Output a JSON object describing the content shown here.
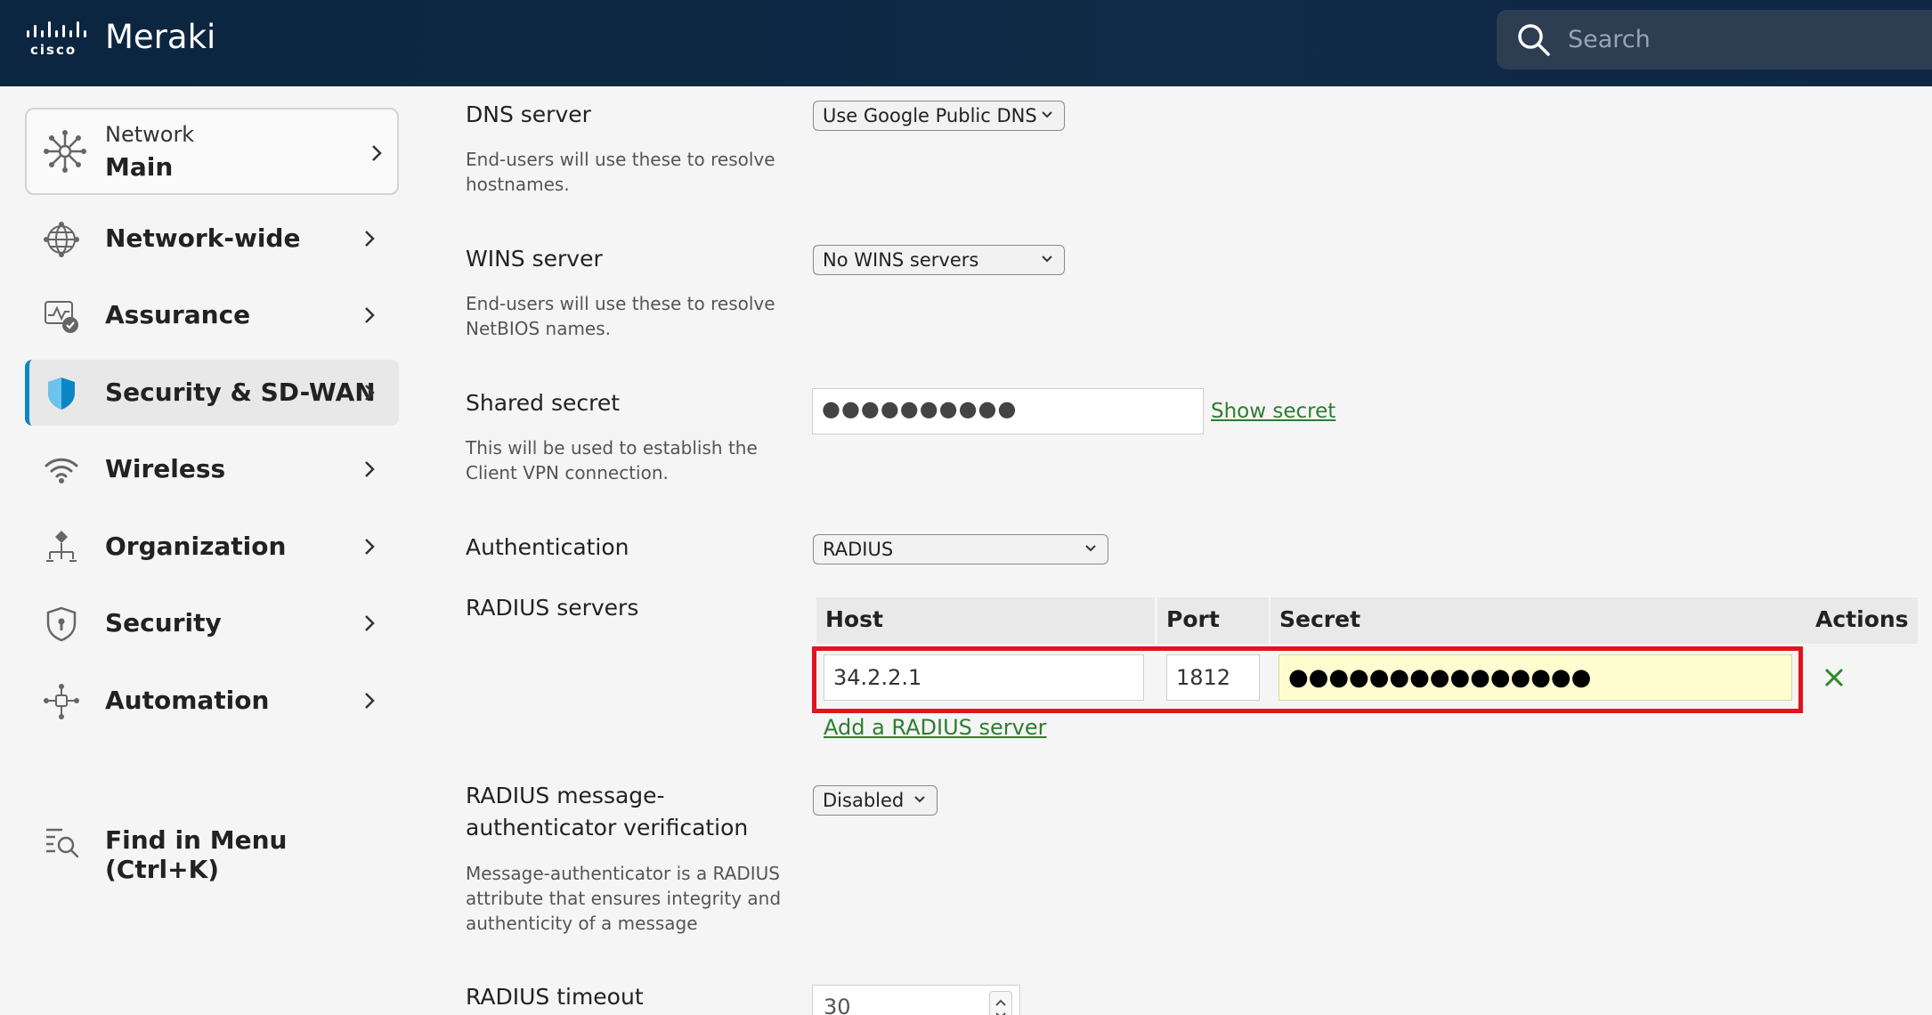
{
  "header": {
    "logo_text": "cisco",
    "app_name": "Meraki",
    "search_placeholder": "Search"
  },
  "sidebar": {
    "network": {
      "label": "Network",
      "value": "Main"
    },
    "items": [
      {
        "label": "Network-wide",
        "icon": "globe-icon"
      },
      {
        "label": "Assurance",
        "icon": "assurance-icon"
      },
      {
        "label": "Security & SD-WAN",
        "icon": "shield-icon",
        "active": true
      },
      {
        "label": "Wireless",
        "icon": "wifi-icon"
      },
      {
        "label": "Organization",
        "icon": "organization-icon"
      },
      {
        "label": "Security",
        "icon": "security-shield-icon"
      },
      {
        "label": "Automation",
        "icon": "automation-icon"
      }
    ],
    "find_menu": "Find in Menu (Ctrl+K)"
  },
  "form": {
    "dns": {
      "label": "DNS server",
      "desc": "End-users will use these to resolve hostnames.",
      "value": "Use Google Public DNS"
    },
    "wins": {
      "label": "WINS server",
      "desc": "End-users will use these to resolve NetBIOS names.",
      "value": "No WINS servers"
    },
    "shared_secret": {
      "label": "Shared secret",
      "desc": "This will be used to establish the Client VPN connection.",
      "masked": "●●●●●●●●●●",
      "show_link": "Show secret"
    },
    "authentication": {
      "label": "Authentication",
      "value": "RADIUS"
    },
    "radius_servers": {
      "label": "RADIUS servers",
      "columns": [
        "Host",
        "Port",
        "Secret",
        "Actions"
      ],
      "rows": [
        {
          "host": "34.2.2.1",
          "port": "1812",
          "secret": "●●●●●●●●●●●●●●●"
        }
      ],
      "add_link": "Add a RADIUS server"
    },
    "msg_auth": {
      "label_line1": "RADIUS message-",
      "label_line2": "authenticator verification",
      "desc": "Message-authenticator is a RADIUS attribute that ensures integrity and authenticity of a message",
      "value": "Disabled"
    },
    "timeout": {
      "label": "RADIUS timeout",
      "value": "30"
    }
  },
  "colors": {
    "header_bg": "#0f2745",
    "active_accent": "#0a86c6",
    "link": "#2e7d32",
    "highlight_border": "#e0151f",
    "secret_bg": "#fdfdd0"
  }
}
